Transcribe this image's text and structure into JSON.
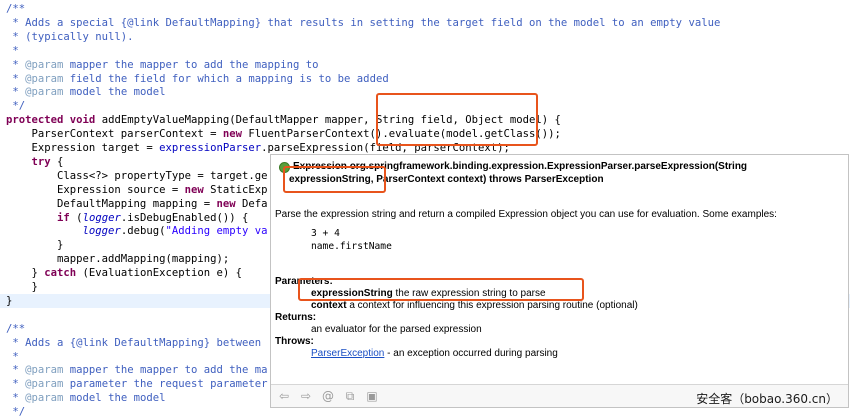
{
  "editor": {
    "lines": [
      {
        "segs": [
          {
            "c": "cm",
            "t": "/**"
          }
        ]
      },
      {
        "segs": [
          {
            "c": "cm",
            "t": " * Adds a special {@link DefaultMapping} that results in setting the target field on the model to an empty value"
          }
        ]
      },
      {
        "segs": [
          {
            "c": "cm",
            "t": " * (typically null)."
          }
        ]
      },
      {
        "segs": [
          {
            "c": "cm",
            "t": " *"
          }
        ]
      },
      {
        "segs": [
          {
            "c": "cm",
            "t": " * "
          },
          {
            "c": "tg",
            "t": "@param"
          },
          {
            "c": "cm",
            "t": " mapper the mapper to add the mapping to"
          }
        ]
      },
      {
        "segs": [
          {
            "c": "cm",
            "t": " * "
          },
          {
            "c": "tg",
            "t": "@param"
          },
          {
            "c": "cm",
            "t": " field the field for which a mapping is to be added"
          }
        ]
      },
      {
        "segs": [
          {
            "c": "cm",
            "t": " * "
          },
          {
            "c": "tg",
            "t": "@param"
          },
          {
            "c": "cm",
            "t": " model the model"
          }
        ]
      },
      {
        "segs": [
          {
            "c": "cm",
            "t": " */"
          }
        ]
      },
      {
        "segs": [
          {
            "c": "kw",
            "t": "protected"
          },
          {
            "c": "",
            "t": " "
          },
          {
            "c": "kw",
            "t": "void"
          },
          {
            "c": "",
            "t": " addEmptyValueMapping(DefaultMapper mapper, String field, Object model) {"
          }
        ]
      },
      {
        "segs": [
          {
            "c": "",
            "t": "    ParserContext parserContext = "
          },
          {
            "c": "kw",
            "t": "new"
          },
          {
            "c": "",
            "t": " FluentParserContext().evaluate(model.getClass());"
          }
        ]
      },
      {
        "segs": [
          {
            "c": "",
            "t": "    Expression target = "
          },
          {
            "c": "fl",
            "t": "expressionParser"
          },
          {
            "c": "",
            "t": ".parseExpression(field, parserContext);"
          }
        ]
      },
      {
        "segs": [
          {
            "c": "",
            "t": "    "
          },
          {
            "c": "kw",
            "t": "try"
          },
          {
            "c": "",
            "t": " {"
          }
        ]
      },
      {
        "segs": [
          {
            "c": "",
            "t": "        Class<?> propertyType = target.ge"
          }
        ]
      },
      {
        "segs": [
          {
            "c": "",
            "t": "        Expression source = "
          },
          {
            "c": "kw",
            "t": "new"
          },
          {
            "c": "",
            "t": " StaticExp"
          }
        ]
      },
      {
        "segs": [
          {
            "c": "",
            "t": "        DefaultMapping mapping = "
          },
          {
            "c": "kw",
            "t": "new"
          },
          {
            "c": "",
            "t": " Defa"
          }
        ]
      },
      {
        "segs": [
          {
            "c": "",
            "t": "        "
          },
          {
            "c": "kw",
            "t": "if"
          },
          {
            "c": "",
            "t": " ("
          },
          {
            "c": "it",
            "t": "logger"
          },
          {
            "c": "",
            "t": ".isDebugEnabled()) {"
          }
        ]
      },
      {
        "segs": [
          {
            "c": "",
            "t": "            "
          },
          {
            "c": "it",
            "t": "logger"
          },
          {
            "c": "",
            "t": ".debug("
          },
          {
            "c": "st",
            "t": "\"Adding empty va"
          }
        ]
      },
      {
        "segs": [
          {
            "c": "",
            "t": "        }"
          }
        ]
      },
      {
        "segs": [
          {
            "c": "",
            "t": "        mapper.addMapping(mapping);"
          }
        ]
      },
      {
        "segs": [
          {
            "c": "",
            "t": "    } "
          },
          {
            "c": "kw",
            "t": "catch"
          },
          {
            "c": "",
            "t": " (EvaluationException e) {"
          }
        ]
      },
      {
        "segs": [
          {
            "c": "",
            "t": "    }"
          }
        ]
      },
      {
        "segs": [
          {
            "c": "",
            "t": "}"
          }
        ]
      },
      {
        "segs": [
          {
            "c": "",
            "t": ""
          }
        ]
      },
      {
        "segs": [
          {
            "c": "cm",
            "t": "/**"
          }
        ]
      },
      {
        "segs": [
          {
            "c": "cm",
            "t": " * Adds a {@link DefaultMapping} between"
          }
        ]
      },
      {
        "segs": [
          {
            "c": "cm",
            "t": " *"
          }
        ]
      },
      {
        "segs": [
          {
            "c": "cm",
            "t": " * "
          },
          {
            "c": "tg",
            "t": "@param"
          },
          {
            "c": "cm",
            "t": " mapper the mapper to add the ma"
          }
        ]
      },
      {
        "segs": [
          {
            "c": "cm",
            "t": " * "
          },
          {
            "c": "tg",
            "t": "@param"
          },
          {
            "c": "cm",
            "t": " parameter the request parameter"
          }
        ]
      },
      {
        "segs": [
          {
            "c": "cm",
            "t": " * "
          },
          {
            "c": "tg",
            "t": "@param"
          },
          {
            "c": "cm",
            "t": " model the model"
          }
        ]
      },
      {
        "segs": [
          {
            "c": "cm",
            "t": " */"
          }
        ]
      }
    ]
  },
  "tooltip": {
    "signature_line1": "Expression org.springframework.binding.expression.ExpressionParser.parseExpression(String",
    "signature_param": "expressionString",
    "signature_rest": ", ParserContext context) throws ParserException",
    "description": "Parse the expression string and return a compiled Expression object you can use for evaluation. Some examples:",
    "example_1": "3 + 4",
    "example_2": "name.firstName",
    "parameters_heading": "Parameters:",
    "param1_name": "expressionString",
    "param1_desc": " the raw expression string to parse",
    "param2_name": "context",
    "param2_desc": " a context for influencing this expression parsing routine (optional)",
    "returns_heading": "Returns:",
    "returns_desc": "an evaluator for the parsed expression",
    "throws_heading": "Throws:",
    "throws_link": "ParserException",
    "throws_desc": " - an exception occurred during parsing",
    "toolbar": [
      {
        "icon": "back-arrow-icon",
        "glyph": "⇦"
      },
      {
        "icon": "forward-arrow-icon",
        "glyph": "⇨"
      },
      {
        "icon": "at-icon",
        "glyph": "@"
      },
      {
        "icon": "open-declaration-icon",
        "glyph": "⧉"
      },
      {
        "icon": "open-external-icon",
        "glyph": "▣"
      }
    ]
  },
  "watermark": "安全客（bobao.360.cn）",
  "colors": {
    "highlight": "#e8541c",
    "current_line": "#e8f2fe"
  }
}
